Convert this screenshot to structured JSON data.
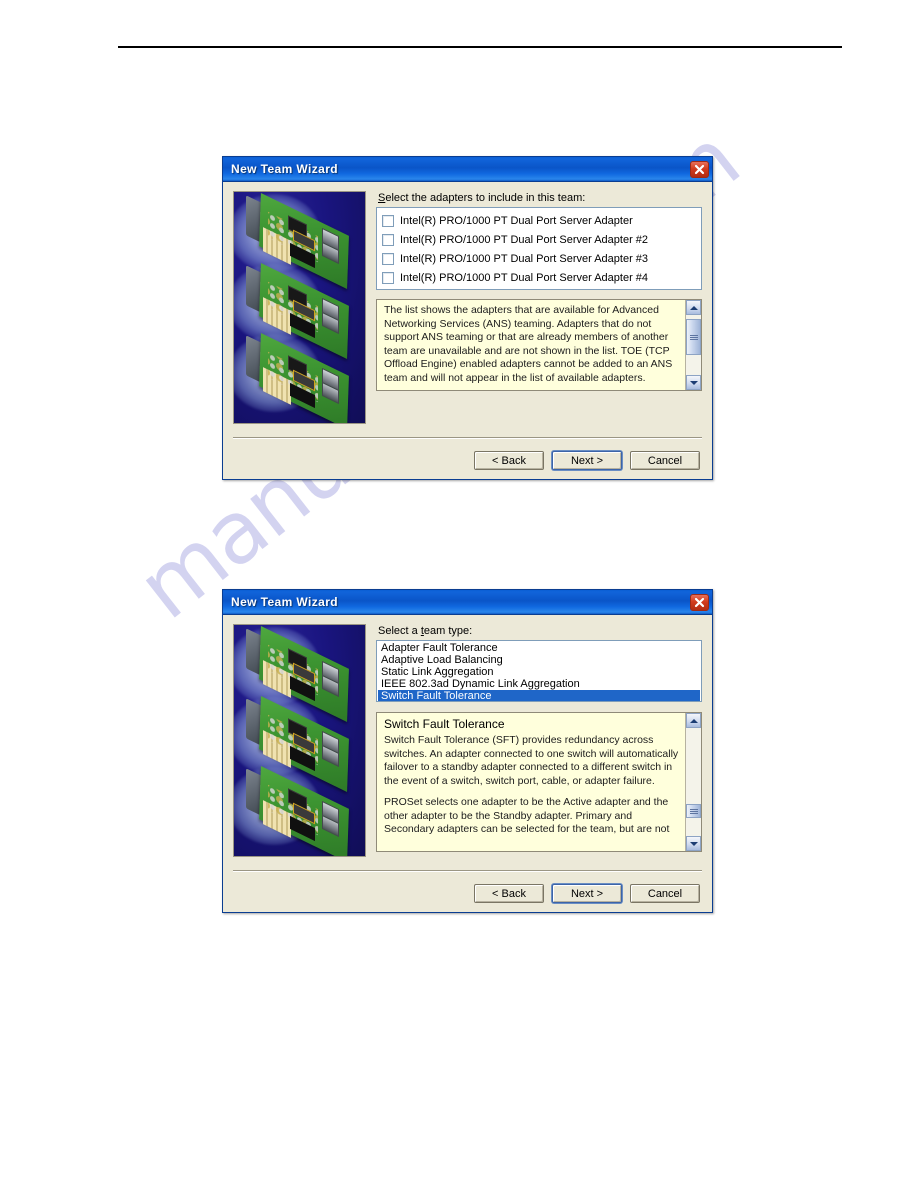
{
  "page": {
    "header_rule": true
  },
  "watermark": {
    "text": "manualshive.com",
    "color": "#b9b9e8"
  },
  "dialogs": [
    {
      "id": "adapters-step",
      "title": "New Team Wizard",
      "close_label": "×",
      "field_label_prefix": "S",
      "field_label_rest": "elect the adapters to include in this team:",
      "adapters": [
        {
          "label": "Intel(R) PRO/1000 PT Dual Port Server Adapter",
          "checked": false
        },
        {
          "label": "Intel(R) PRO/1000 PT Dual Port Server Adapter #2",
          "checked": false
        },
        {
          "label": "Intel(R) PRO/1000 PT Dual Port Server Adapter #3",
          "checked": false
        },
        {
          "label": "Intel(R) PRO/1000 PT Dual Port Server Adapter #4",
          "checked": false
        }
      ],
      "info": {
        "title": "",
        "paragraphs": [
          "The list shows the adapters that are available for Advanced Networking Services (ANS) teaming. Adapters that do not support ANS teaming or that are already members of another team are unavailable and are not shown in the list. TOE (TCP Offload Engine) enabled adapters cannot be added to an ANS team and will not appear in the list of available adapters."
        ]
      },
      "buttons": {
        "back": "< Back",
        "back_prefix": "< ",
        "back_mnemonic": "B",
        "back_rest": "ack",
        "next_prefix": "N",
        "next_mnemonic": "e",
        "next_rest": "xt >",
        "cancel": "Cancel"
      }
    },
    {
      "id": "teamtype-step",
      "title": "New Team Wizard",
      "close_label": "×",
      "field_label_prefix": "Select a ",
      "field_label_mnemonic": "t",
      "field_label_rest": "eam type:",
      "team_types": [
        {
          "label": "Adapter Fault Tolerance",
          "selected": false
        },
        {
          "label": "Adaptive Load Balancing",
          "selected": false
        },
        {
          "label": "Static Link Aggregation",
          "selected": false
        },
        {
          "label": "IEEE 802.3ad Dynamic Link Aggregation",
          "selected": false
        },
        {
          "label": "Switch Fault Tolerance",
          "selected": true
        }
      ],
      "selected_value": "Switch Fault Tolerance",
      "info": {
        "title": "Switch Fault Tolerance",
        "paragraphs": [
          "Switch Fault Tolerance (SFT) provides redundancy across switches. An adapter connected to one switch will automatically failover to a standby adapter connected to a different switch in the event of a switch, switch port, cable, or adapter failure.",
          "PROSet selects one adapter to be the Active adapter and the other adapter to be the Standby adapter.  Primary and Secondary adapters can be selected for the team, but are not"
        ]
      },
      "buttons": {
        "back": "< Back",
        "cancel": "Cancel"
      }
    }
  ],
  "common": {
    "back_label": "< Back",
    "next_label": "Next >",
    "cancel_label": "Cancel",
    "artwork_alt": "intel-network-adapter-cards"
  },
  "colors": {
    "titlebar": "#0a55c8",
    "dialog_face": "#ece9d8",
    "info_panel": "#ffffdc",
    "selection": "#1f66c8",
    "close_button": "#d23c1e"
  }
}
